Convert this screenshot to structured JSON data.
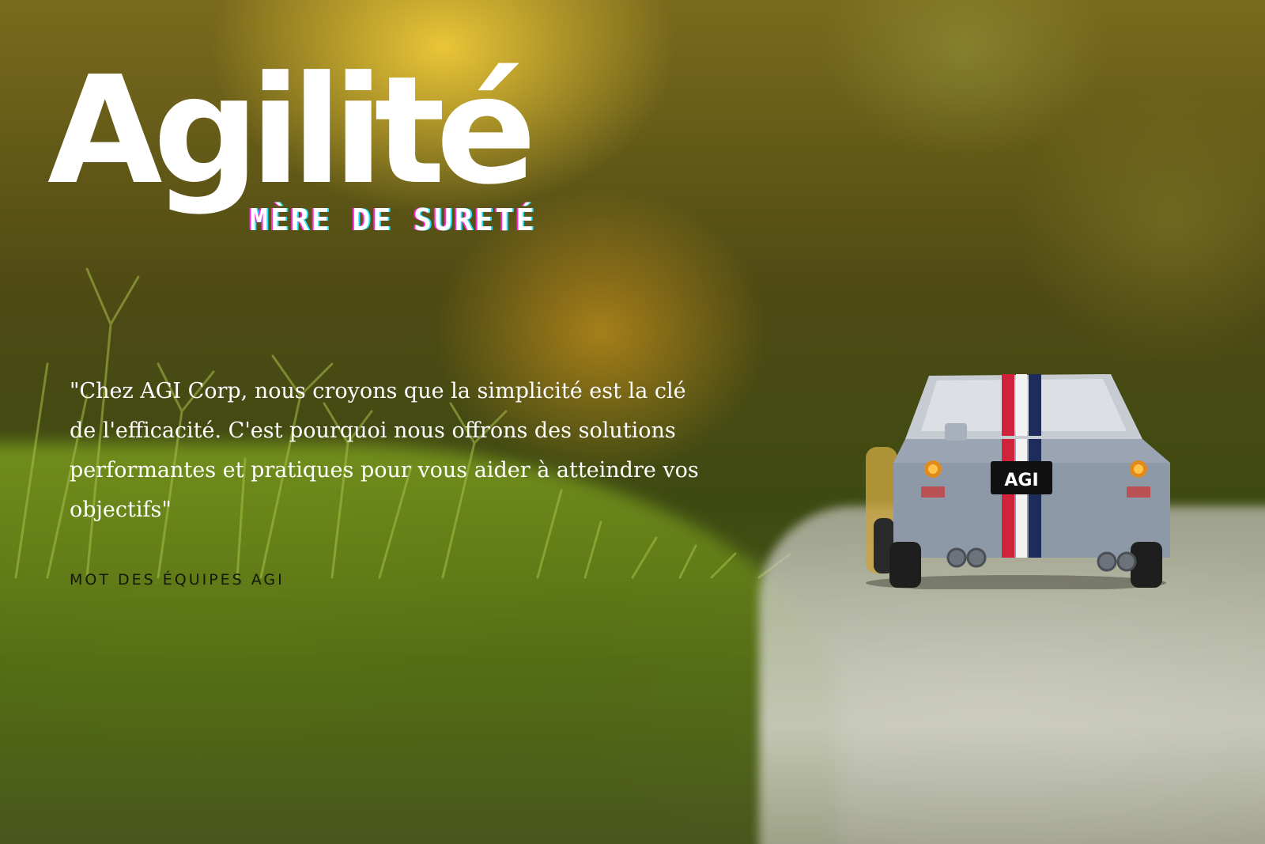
{
  "headline": {
    "title": "Agilité",
    "subtitle": "Mère de sureté"
  },
  "quote": {
    "text": "\"Chez AGI Corp, nous croyons que la simplicité est la clé de l'efficacité. C'est pourquoi nous offrons des solutions performantes et pratiques pour vous aider à atteindre vos objectifs\"",
    "attribution": "MOT DES ÉQUIPES AGI"
  },
  "photo": {
    "car_plate": "AGI"
  },
  "colors": {
    "headline": "#ffffff",
    "subtitle_glitch_magenta": "#ff2bd6",
    "subtitle_glitch_cyan": "#20e4ff",
    "stripe_red": "#d0223a",
    "stripe_navy": "#1d2c5a",
    "car_body": "#9aa4b3"
  }
}
